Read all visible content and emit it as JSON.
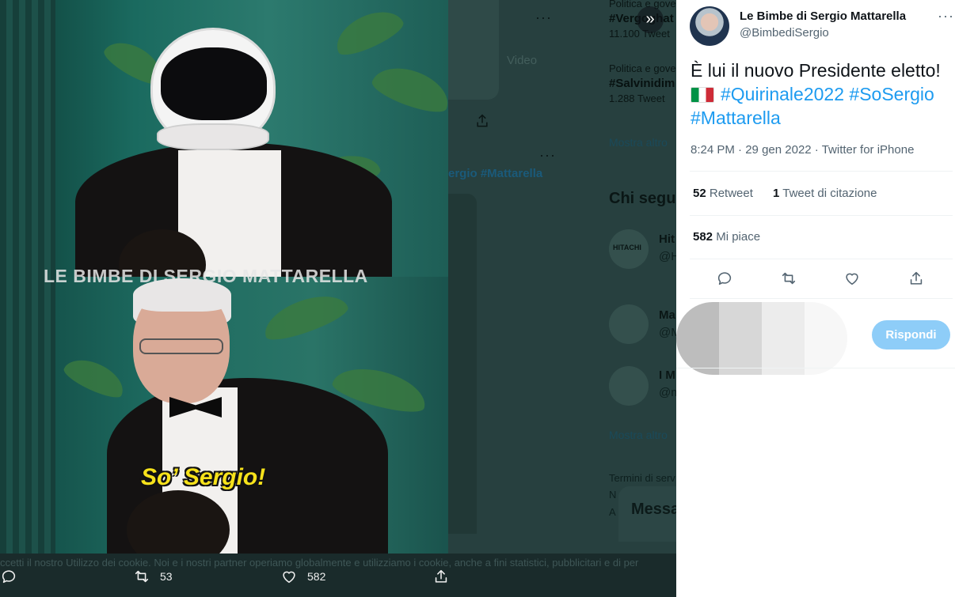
{
  "tweet": {
    "author_name": "Le Bimbe di Sergio Mattarella",
    "author_handle": "@BimbediSergio",
    "text_main": "È lui il nuovo Presidente eletto!",
    "hashtags": [
      "#Quirinale2022",
      "#SoSergio",
      "#Mattarella"
    ],
    "flag_icon": "italy-flag-icon",
    "time": "8:24 PM",
    "date": "29 gen 2022",
    "source": "Twitter for iPhone",
    "retweet_count": "52",
    "retweet_label": "Retweet",
    "quote_count": "1",
    "quote_label": "Tweet di citazione",
    "like_count": "582",
    "like_label": "Mi piace",
    "reply_button": "Rispondi",
    "more_glyph": "···"
  },
  "media": {
    "watermark": "LE BIMBE DI SERGIO MATTARELLA",
    "caption": "So’ Sergio!"
  },
  "bottom_bar": {
    "cookie_text": "ccetti il nostro Utilizzo dei cookie. Noi e i nostri partner operiamo globalmente e utilizziamo i cookie, anche a fini statistici, pubblicitari e di per",
    "retweet_count": "53",
    "like_count": "582"
  },
  "background": {
    "trend1_context": "Politica e gove",
    "trend1_tag": "#Vergoghat",
    "trend1_count": "11.100 Tweet",
    "trend2_context": "Politica e gove",
    "trend2_tag": "#Salvinidim",
    "trend2_count": "1.288 Tweet",
    "video_tab": "Video",
    "show_more_1": "Mostra altro",
    "hashtag_fragment": "ergio #Mattarella",
    "who_to_follow": "Chi segu",
    "acct1_name": "Hit",
    "acct1_logo": "HITACHI",
    "acct1_handle": "@H",
    "acct2_name": "Ma",
    "acct2_handle": "@M",
    "acct3_name": "I M",
    "acct3_handle": "@m",
    "show_more_2": "Mostra altro",
    "terms": "Termini di serv",
    "terms2": "N",
    "terms3": "A",
    "messages": "Messa"
  },
  "colors": {
    "link": "#1d9bf0",
    "reply_button_bg": "#8ecdf8",
    "caption_yellow": "#f7e21b"
  }
}
